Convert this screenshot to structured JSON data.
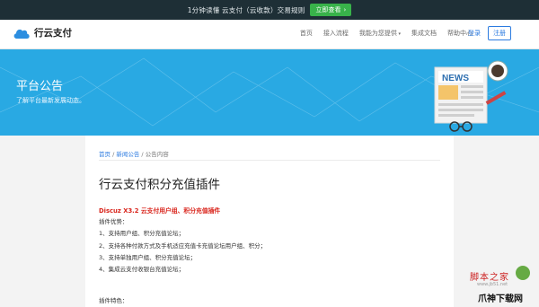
{
  "topbar": {
    "announcement": "1分钟读懂 云支付（云收款）交易规则",
    "button_label": "立即查看"
  },
  "navbar": {
    "logo_text": "行云支付",
    "links": [
      "首页",
      "接入流程",
      "我能为您提供",
      "集成文档",
      "帮助中心"
    ],
    "login": "登录",
    "register": "注册"
  },
  "banner": {
    "title": "平台公告",
    "subtitle": "了解平台最新发展动态。",
    "art_label": "NEWS"
  },
  "breadcrumb": {
    "home": "首页",
    "news": "新闻公告",
    "current": "公告内容"
  },
  "article": {
    "title": "行云支付积分充值插件",
    "highlight": "Discuz X3.2 云支付用户组、积分充值插件",
    "lines": [
      "插件优势：",
      "1、支持用户组、积分充值论坛；",
      "2、支持各种付款方式及手机适应充值卡充值论坛用户组、积分；",
      "3、支持单独用户组、积分充值论坛；",
      "4、集成云支付收银台充值论坛；"
    ],
    "features": "插件特色："
  },
  "watermarks": {
    "site1": "脚本之家",
    "site1_url": "www.jb51.net",
    "site2": "爪神下载网"
  },
  "colors": {
    "banner_bg": "#29a9e3",
    "topbar_bg": "#1e2f36",
    "accent": "#2c7be0",
    "highlight": "#d9241b",
    "cta_green": "#38b24a"
  }
}
